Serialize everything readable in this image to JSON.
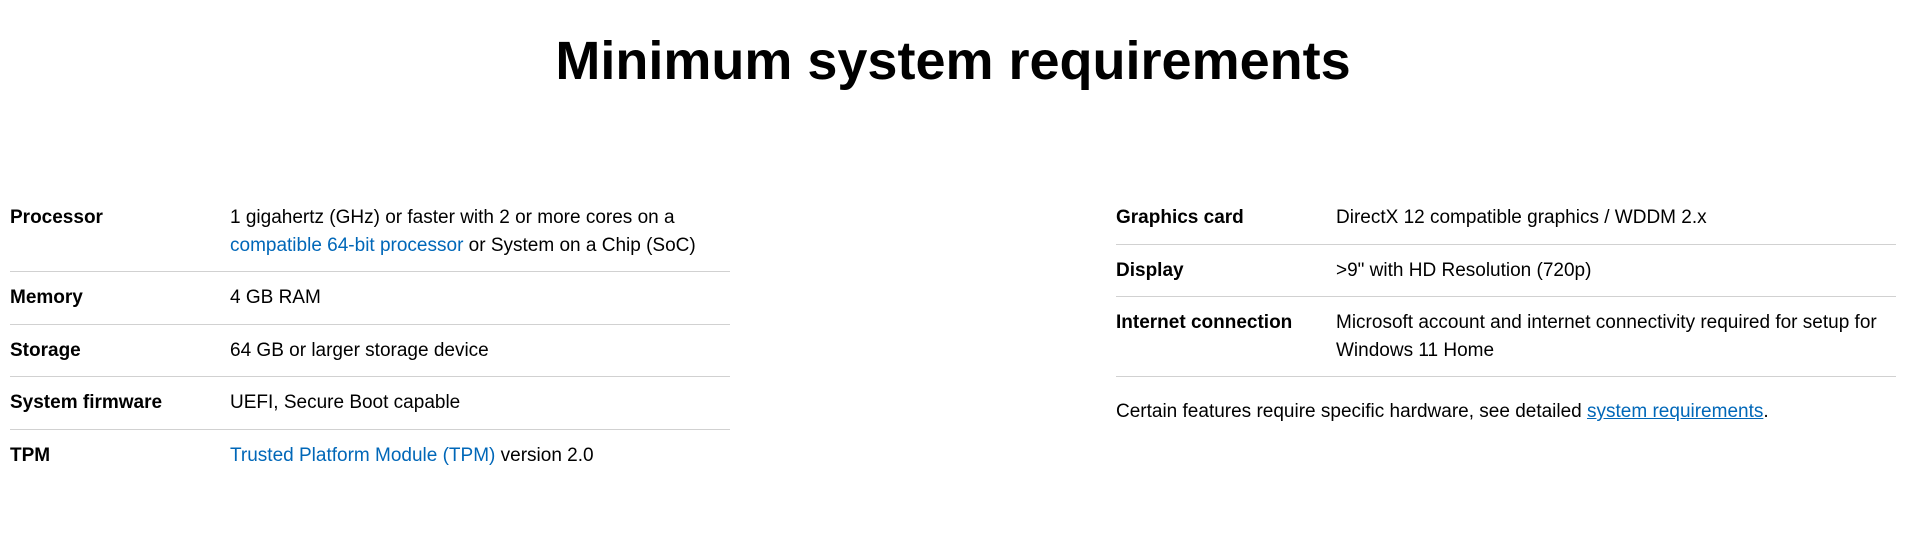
{
  "title": "Minimum system requirements",
  "left": [
    {
      "label": "Processor",
      "value_pre": "1 gigahertz (GHz) or faster with 2 or more cores on a ",
      "link": "compatible 64-bit processor",
      "value_post": " or System on a Chip (SoC)"
    },
    {
      "label": "Memory",
      "value": "4 GB RAM"
    },
    {
      "label": "Storage",
      "value": "64 GB or larger storage device"
    },
    {
      "label": "System firmware",
      "value": "UEFI, Secure Boot capable"
    },
    {
      "label": "TPM",
      "link": "Trusted Platform Module (TPM)",
      "value_post": " version 2.0"
    }
  ],
  "right": [
    {
      "label": "Graphics card",
      "value": "DirectX 12 compatible graphics / WDDM 2.x"
    },
    {
      "label": "Display",
      "value": ">9\" with HD Resolution (720p)"
    },
    {
      "label": "Internet connection",
      "value": "Microsoft account and internet connectivity required for setup for Windows 11 Home"
    }
  ],
  "footnote": {
    "pre": "Certain features require specific hardware, see detailed ",
    "link": "system requirements",
    "post": "."
  }
}
